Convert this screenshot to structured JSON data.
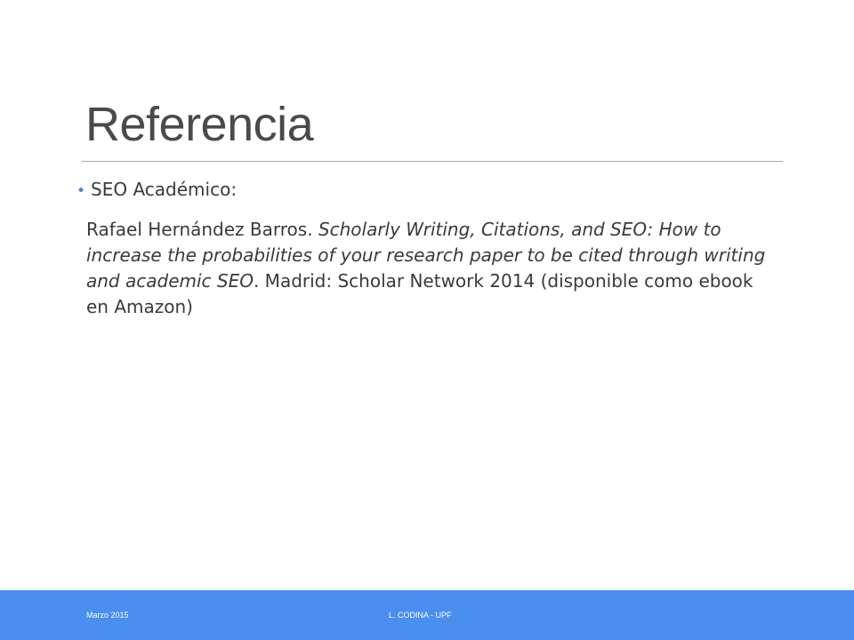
{
  "slide": {
    "title": "Referencia",
    "bullet": "SEO Académico:",
    "reference": {
      "author": "Rafael Hernández Barros. ",
      "work_title": "Scholarly Writing, Citations, and SEO: How to increase the probabilities of your research paper to be cited through writing and academic SEO",
      "publication": ". Madrid: Scholar Network 2014 (disponible como ebook en Amazon)"
    }
  },
  "footer": {
    "date": "Marzo 2015",
    "author": "L. CODINA - UPF"
  },
  "colors": {
    "footer_bar": "#4a8ef0",
    "bullet_accent": "#3d86e6",
    "title_text": "#4a4a4a"
  }
}
